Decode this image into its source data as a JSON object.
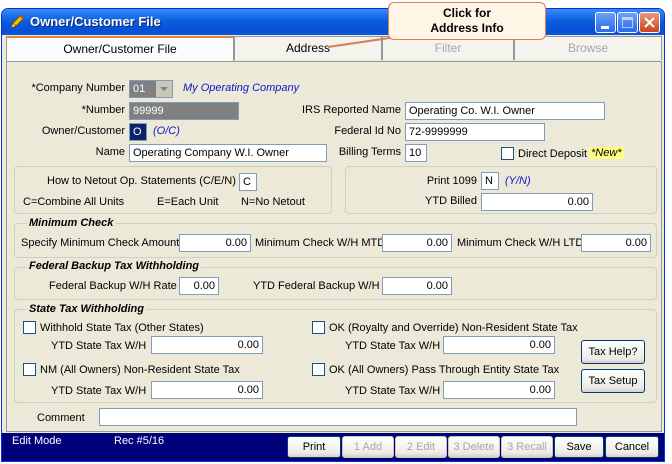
{
  "window": {
    "title": "Owner/Customer File"
  },
  "tooltip": {
    "line1": "Click for",
    "line2": "Address Info"
  },
  "tabs": [
    {
      "label": "Owner/Customer File"
    },
    {
      "label": "Address"
    },
    {
      "label": "Filter"
    },
    {
      "label": "Browse"
    }
  ],
  "company": {
    "label": "*Company Number",
    "value": "01",
    "name": "My Operating Company"
  },
  "number": {
    "label": "*Number",
    "value": "99999"
  },
  "owner_customer": {
    "label": "Owner/Customer",
    "value": "O",
    "hint": "(O/C)"
  },
  "name": {
    "label": "Name",
    "value": "Operating Company W.I.  Owner"
  },
  "irs_name": {
    "label": "IRS Reported Name",
    "value": "Operating Co. W.I. Owner"
  },
  "federal_id": {
    "label": "Federal Id No",
    "value": "72-9999999"
  },
  "billing_terms": {
    "label": "Billing Terms",
    "value": "10"
  },
  "direct_deposit": {
    "label": "Direct Deposit",
    "badge": "*New*"
  },
  "netout": {
    "label": "How to Netout Op. Statements (C/E/N)",
    "value": "C",
    "opt_c": "C=Combine All Units",
    "opt_e": "E=Each Unit",
    "opt_n": "N=No Netout"
  },
  "print1099": {
    "label": "Print 1099",
    "value": "N",
    "hint": "(Y/N)"
  },
  "ytd_billed": {
    "label": "YTD Billed",
    "value": "0.00"
  },
  "minimum_check": {
    "title": "Minimum Check",
    "specify_label": "Specify Minimum Check Amount",
    "specify_value": "0.00",
    "wh_mtd_label": "Minimum Check W/H MTD",
    "wh_mtd_value": "0.00",
    "wh_ltd_label": "Minimum Check W/H LTD",
    "wh_ltd_value": "0.00"
  },
  "backup_tax": {
    "title": "Federal Backup Tax Withholding",
    "rate_label": "Federal Backup W/H Rate",
    "rate_value": "0.00",
    "ytd_label": "YTD Federal Backup W/H",
    "ytd_value": "0.00"
  },
  "state_tax": {
    "title": "State Tax Withholding",
    "ytd_label": "YTD State Tax W/H",
    "items": [
      {
        "label": "Withhold State Tax (Other States)",
        "value": "0.00"
      },
      {
        "label": "OK (Royalty and Override) Non-Resident State Tax",
        "value": "0.00"
      },
      {
        "label": "NM (All Owners) Non-Resident State Tax",
        "value": "0.00"
      },
      {
        "label": "OK (All Owners) Pass Through Entity State Tax",
        "value": "0.00"
      }
    ],
    "tax_help": "Tax Help?",
    "tax_setup": "Tax Setup"
  },
  "comment": {
    "label": "Comment",
    "value": ""
  },
  "status": {
    "mode": "Edit Mode",
    "record": "Rec #5/16"
  },
  "buttons": {
    "print": "Print",
    "add": "1 Add",
    "edit": "2 Edit",
    "delete": "3 Delete",
    "recall": "3 Recall",
    "save": "Save",
    "cancel": "Cancel"
  },
  "colors": {
    "titlebar": "#0A5FE0",
    "statusbar": "#00007B",
    "hint_blue": "#1212C8",
    "tooltip_border": "#E07B5A"
  }
}
